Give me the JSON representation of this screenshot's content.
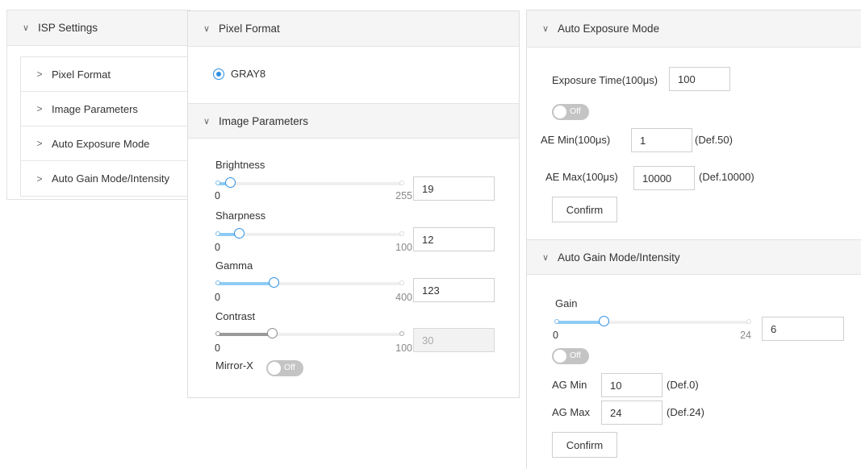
{
  "isp": {
    "title": "ISP Settings",
    "items": [
      {
        "label": "Pixel Format"
      },
      {
        "label": "Image Parameters"
      },
      {
        "label": "Auto Exposure Mode"
      },
      {
        "label": "Auto Gain Mode/Intensity"
      }
    ]
  },
  "pixel_format": {
    "title": "Pixel Format",
    "option": "GRAY8",
    "selected": true
  },
  "image_params": {
    "title": "Image Parameters",
    "brightness": {
      "label": "Brightness",
      "min": "0",
      "max": "255",
      "value": "19",
      "fraction": 0.075
    },
    "sharpness": {
      "label": "Sharpness",
      "min": "0",
      "max": "100",
      "value": "12",
      "fraction": 0.12
    },
    "gamma": {
      "label": "Gamma",
      "min": "0",
      "max": "400",
      "value": "123",
      "fraction": 0.3075
    },
    "contrast": {
      "label": "Contrast",
      "min": "0",
      "max": "100",
      "value": "30",
      "fraction": 0.3,
      "disabled": true
    },
    "mirror_x": {
      "label": "Mirror-X",
      "state": "Off"
    }
  },
  "auto_exposure": {
    "title": "Auto Exposure Mode",
    "exposure_time_label": "Exposure Time(100μs)",
    "exposure_time_value": "100",
    "toggle_state": "Off",
    "ae_min_label": "AE Min(100μs)",
    "ae_min_value": "1",
    "ae_min_default": "(Def.50)",
    "ae_max_label": "AE Max(100μs)",
    "ae_max_value": "10000",
    "ae_max_default": "(Def.10000)",
    "confirm_label": "Confirm"
  },
  "auto_gain": {
    "title": "Auto Gain Mode/Intensity",
    "gain_label": "Gain",
    "gain_min": "0",
    "gain_max": "24",
    "gain_value": "6",
    "gain_fraction": 0.25,
    "toggle_state": "Off",
    "ag_min_label": "AG Min",
    "ag_min_value": "10",
    "ag_min_default": "(Def.0)",
    "ag_max_label": "AG Max",
    "ag_max_value": "24",
    "ag_max_default": "(Def.24)",
    "confirm_label": "Confirm"
  },
  "colors": {
    "accent": "#2d8fe3",
    "slider_fill": "#8ecbf4",
    "toggle_off": "#c4c4c4"
  }
}
